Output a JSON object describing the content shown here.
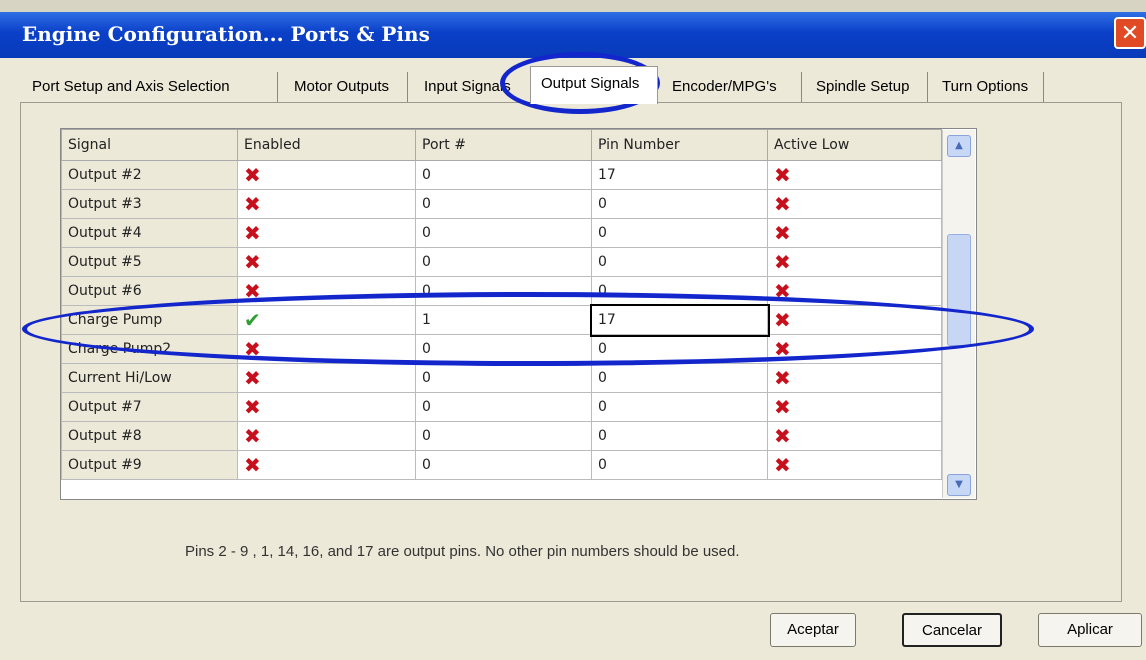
{
  "window": {
    "title": "Engine Configuration... Ports & Pins",
    "close_glyph": "✕"
  },
  "tabs": [
    {
      "label": "Port Setup and Axis Selection"
    },
    {
      "label": "Motor Outputs"
    },
    {
      "label": "Input Signals"
    },
    {
      "label": "Output Signals"
    },
    {
      "label": "Encoder/MPG's"
    },
    {
      "label": "Spindle Setup"
    },
    {
      "label": "Turn Options"
    }
  ],
  "active_tab": "Output Signals",
  "table": {
    "columns": [
      "Signal",
      "Enabled",
      "Port #",
      "Pin Number",
      "Active Low"
    ],
    "rows": [
      {
        "signal": "Output #2",
        "enabled": false,
        "port": "0",
        "pin": "17",
        "active_low": false
      },
      {
        "signal": "Output #3",
        "enabled": false,
        "port": "0",
        "pin": "0",
        "active_low": false
      },
      {
        "signal": "Output #4",
        "enabled": false,
        "port": "0",
        "pin": "0",
        "active_low": false
      },
      {
        "signal": "Output #5",
        "enabled": false,
        "port": "0",
        "pin": "0",
        "active_low": false
      },
      {
        "signal": "Output #6",
        "enabled": false,
        "port": "0",
        "pin": "0",
        "active_low": false
      },
      {
        "signal": "Charge Pump",
        "enabled": true,
        "port": "1",
        "pin": "17",
        "active_low": false
      },
      {
        "signal": "Charge Pump2",
        "enabled": false,
        "port": "0",
        "pin": "0",
        "active_low": false
      },
      {
        "signal": "Current Hi/Low",
        "enabled": false,
        "port": "0",
        "pin": "0",
        "active_low": false
      },
      {
        "signal": "Output #7",
        "enabled": false,
        "port": "0",
        "pin": "0",
        "active_low": false
      },
      {
        "signal": "Output #8",
        "enabled": false,
        "port": "0",
        "pin": "0",
        "active_low": false
      },
      {
        "signal": "Output #9",
        "enabled": false,
        "port": "0",
        "pin": "0",
        "active_low": false
      }
    ]
  },
  "icons": {
    "enabled": "check-icon",
    "disabled": "x-icon",
    "scroll_up": "scroll-up-icon",
    "scroll_down": "scroll-down-icon"
  },
  "glyphs": {
    "check": "✔",
    "cross": "✖",
    "up": "▲",
    "down": "▼"
  },
  "note": "Pins 2 - 9 , 1, 14, 16, and 17 are output pins. No  other pin numbers should be used.",
  "buttons": {
    "ok": "Aceptar",
    "cancel": "Cancelar",
    "apply": "Aplicar"
  },
  "colors": {
    "title_bar": "#0a3fc8",
    "annotation": "#1226cc",
    "cross": "#c8101d",
    "check": "#2f9e2f"
  }
}
